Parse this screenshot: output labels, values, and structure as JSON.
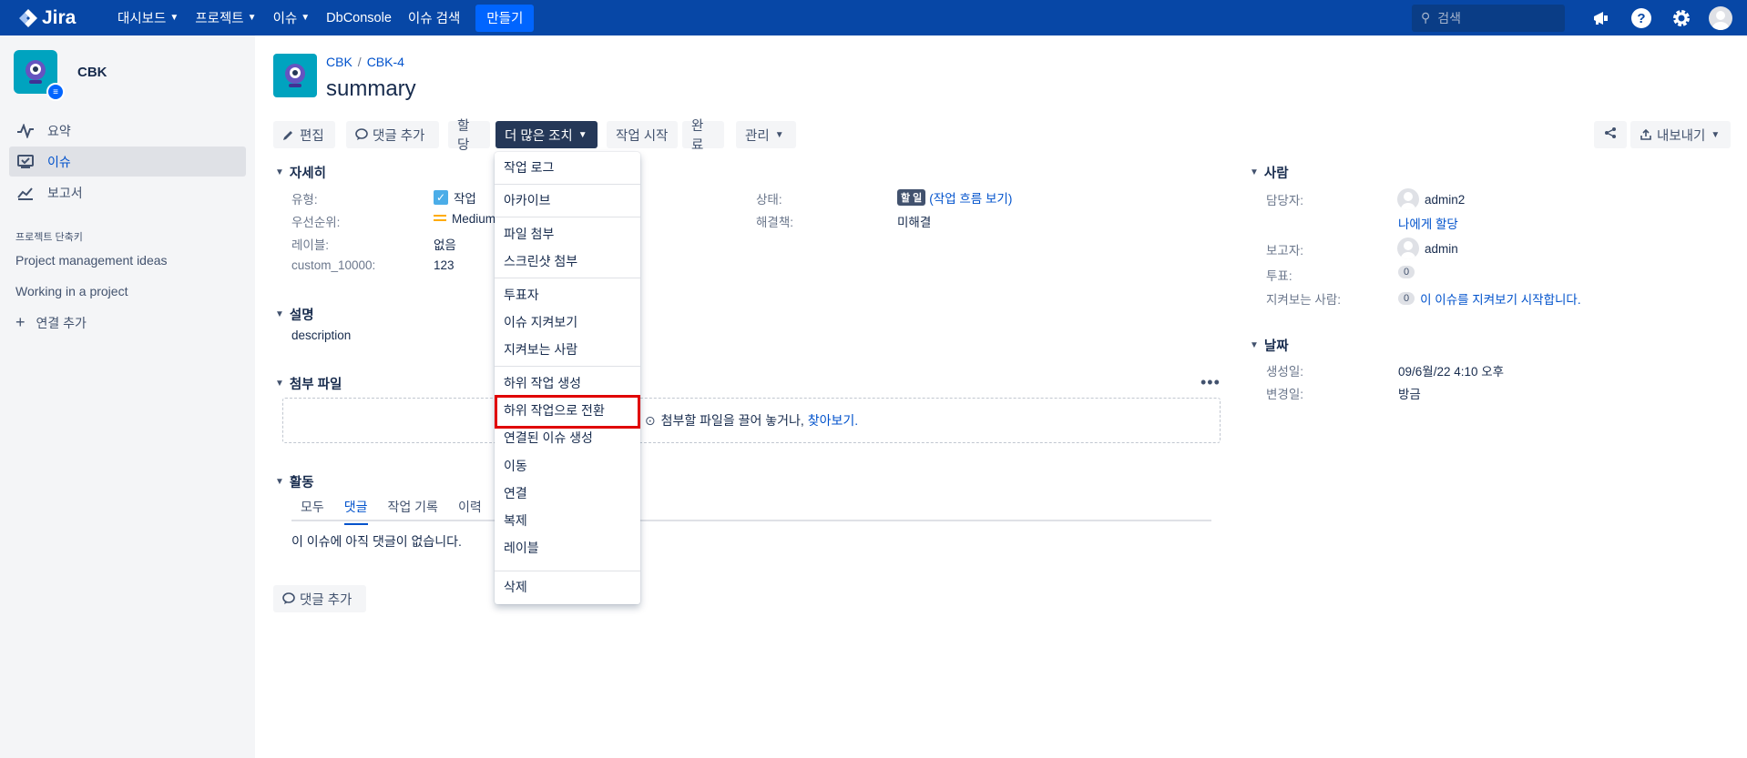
{
  "nav": {
    "logo": "Jira",
    "items": [
      {
        "label": "대시보드",
        "has_chevron": true
      },
      {
        "label": "프로젝트",
        "has_chevron": true
      },
      {
        "label": "이슈",
        "has_chevron": true
      },
      {
        "label": "DbConsole",
        "has_chevron": false
      },
      {
        "label": "이슈 검색",
        "has_chevron": false
      }
    ],
    "create": "만들기",
    "search_placeholder": "검색"
  },
  "sidebar": {
    "project_name": "CBK",
    "items": [
      {
        "label": "요약",
        "icon": "pulse-icon"
      },
      {
        "label": "이슈",
        "icon": "issues-icon",
        "active": true
      },
      {
        "label": "보고서",
        "icon": "chart-icon"
      }
    ],
    "shortcuts_title": "프로젝트 단축키",
    "shortcuts": [
      "Project management ideas",
      "Working in a project"
    ],
    "add_link": "연결 추가"
  },
  "issue": {
    "breadcrumb_project": "CBK",
    "breadcrumb_key": "CBK-4",
    "title": "summary"
  },
  "toolbar": {
    "edit": "편집",
    "add_comment": "댓글 추가",
    "assign": "할당",
    "more_actions": "더 많은 조치",
    "start_work": "작업 시작",
    "done": "완료",
    "manage": "관리",
    "export": "내보내기"
  },
  "details": {
    "title": "자세히",
    "type_label": "유형:",
    "type_value": "작업",
    "priority_label": "우선순위:",
    "priority_value": "Medium",
    "labels_label": "레이블:",
    "labels_value": "없음",
    "custom_label": "custom_10000:",
    "custom_value": "123",
    "status_label": "상태:",
    "status_value": "할 일",
    "workflow_link": "(작업 흐름 보기)",
    "resolution_label": "해결책:",
    "resolution_value": "미해결"
  },
  "description": {
    "title": "설명",
    "text": "description"
  },
  "attachments": {
    "title": "첨부 파일",
    "drop_text": "첨부할 파일을 끌어 놓거나,",
    "browse": "찾아보기."
  },
  "activity": {
    "title": "활동",
    "tabs": [
      "모두",
      "댓글",
      "작업 기록",
      "이력"
    ],
    "active_tab": 1,
    "empty": "이 이슈에 아직 댓글이 없습니다.",
    "add_comment": "댓글 추가"
  },
  "people": {
    "title": "사람",
    "assignee_label": "담당자:",
    "assignee": "admin2",
    "assign_me": "나에게 할당",
    "reporter_label": "보고자:",
    "reporter": "admin",
    "votes_label": "투표:",
    "votes": "0",
    "watchers_label": "지켜보는 사람:",
    "watchers": "0",
    "watch_link": "이 이슈를 지켜보기 시작합니다."
  },
  "dates": {
    "title": "날짜",
    "created_label": "생성일:",
    "created": "09/6월/22 4:10 오후",
    "updated_label": "변경일:",
    "updated": "방금"
  },
  "dropdown": {
    "items": [
      "작업 로그",
      "아카이브",
      "파일 첨부",
      "스크린샷 첨부",
      "투표자",
      "이슈 지켜보기",
      "지켜보는 사람",
      "하위 작업 생성",
      "하위 작업으로 전환",
      "연결된 이슈 생성",
      "이동",
      "연결",
      "복제",
      "레이블",
      "삭제"
    ],
    "highlighted": "하위 작업으로 전환"
  },
  "colors": {
    "nav_bg": "#0747a6",
    "primary": "#0052cc",
    "create_btn": "#0065ff",
    "highlight": "#e00000"
  }
}
